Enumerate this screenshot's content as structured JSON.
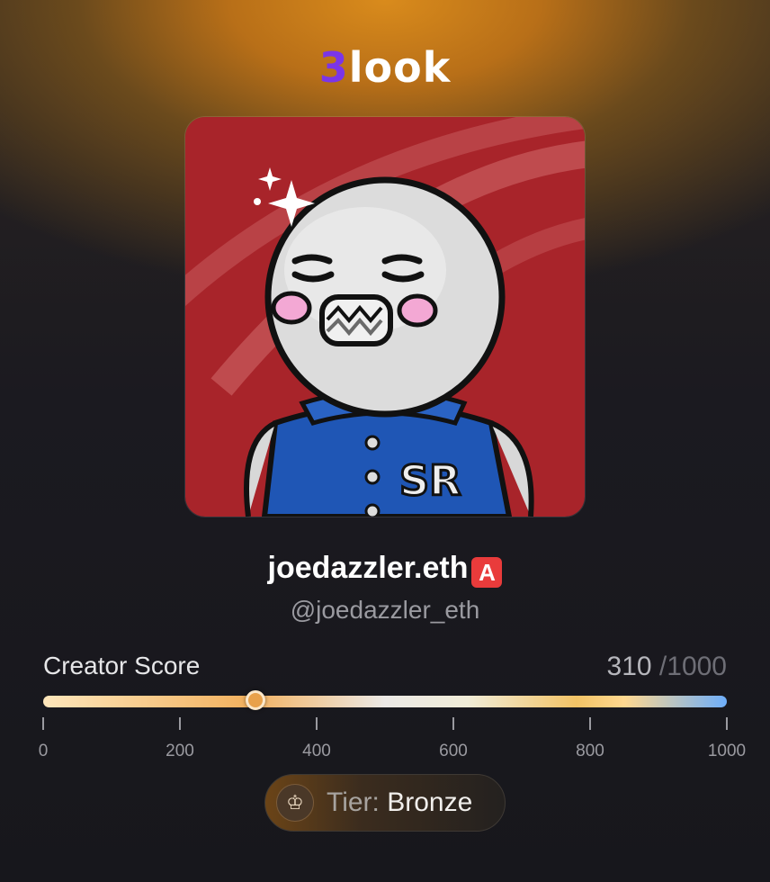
{
  "brand": {
    "logo_number": "3",
    "logo_text": "look"
  },
  "profile": {
    "display_name": "joedazzler.eth",
    "badge_glyph": "A",
    "handle": "@joedazzler_eth",
    "avatar": "cartoon-character-varsity-jacket"
  },
  "creator_score": {
    "label": "Creator Score",
    "value": "310",
    "max_label": "/1000",
    "value_numeric": 310,
    "max_numeric": 1000,
    "scale_ticks": [
      "0",
      "200",
      "400",
      "600",
      "800",
      "1000"
    ]
  },
  "tier": {
    "key_label": "Tier:",
    "value_label": "Bronze",
    "icon": "chess-king-icon"
  },
  "colors": {
    "accent_purple": "#7b35e8",
    "background_glow": "#d98b1c",
    "thumb": "#e8a14b",
    "bar_blue_end": "#6eaefa"
  }
}
